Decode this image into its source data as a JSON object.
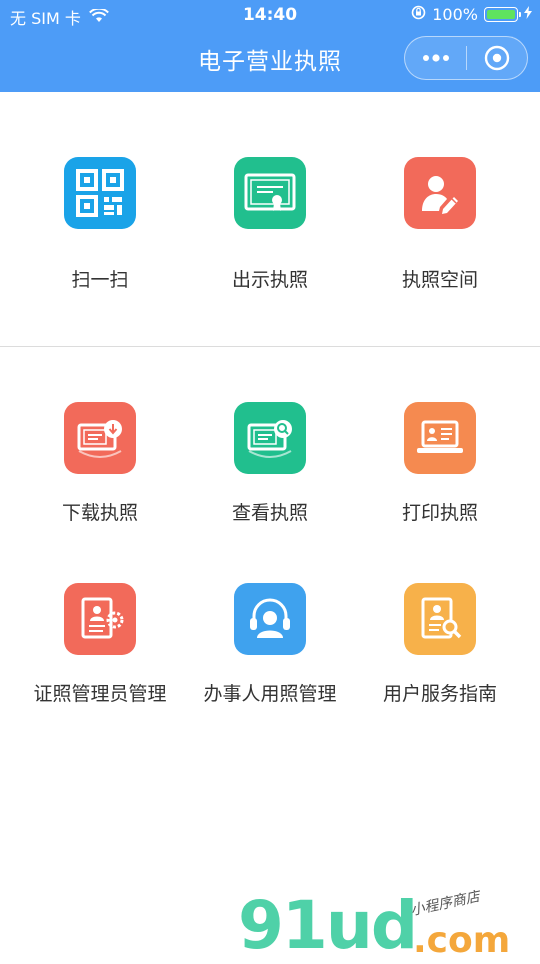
{
  "status_bar": {
    "carrier": "无 SIM 卡",
    "time": "14:40",
    "battery": "100%"
  },
  "header": {
    "title": "电子营业执照",
    "capsule_icons": [
      "more-dots-icon",
      "close-circle-icon"
    ]
  },
  "top_section": {
    "items": [
      {
        "label": "扫一扫",
        "icon": "qr-code-icon",
        "color": "#1aa3e8"
      },
      {
        "label": "出示执照",
        "icon": "certificate-icon",
        "color": "#21bf8e"
      },
      {
        "label": "执照空间",
        "icon": "user-edit-icon",
        "color": "#f26a5a"
      }
    ]
  },
  "bottom_section": {
    "items": [
      {
        "label": "下载执照",
        "icon": "license-download-icon",
        "color": "#f26a5a"
      },
      {
        "label": "查看执照",
        "icon": "license-search-icon",
        "color": "#21bf8e"
      },
      {
        "label": "打印执照",
        "icon": "laptop-print-icon",
        "color": "#f58a50"
      },
      {
        "label": "证照管理员管理",
        "icon": "document-gear-icon",
        "color": "#f26a5a"
      },
      {
        "label": "办事人用照管理",
        "icon": "headset-user-icon",
        "color": "#3fa2ee"
      },
      {
        "label": "用户服务指南",
        "icon": "document-magnifier-icon",
        "color": "#f7b14a"
      }
    ]
  },
  "watermark": {
    "main": "91ud",
    "sub": ".com",
    "tagline": "小程序商店"
  }
}
